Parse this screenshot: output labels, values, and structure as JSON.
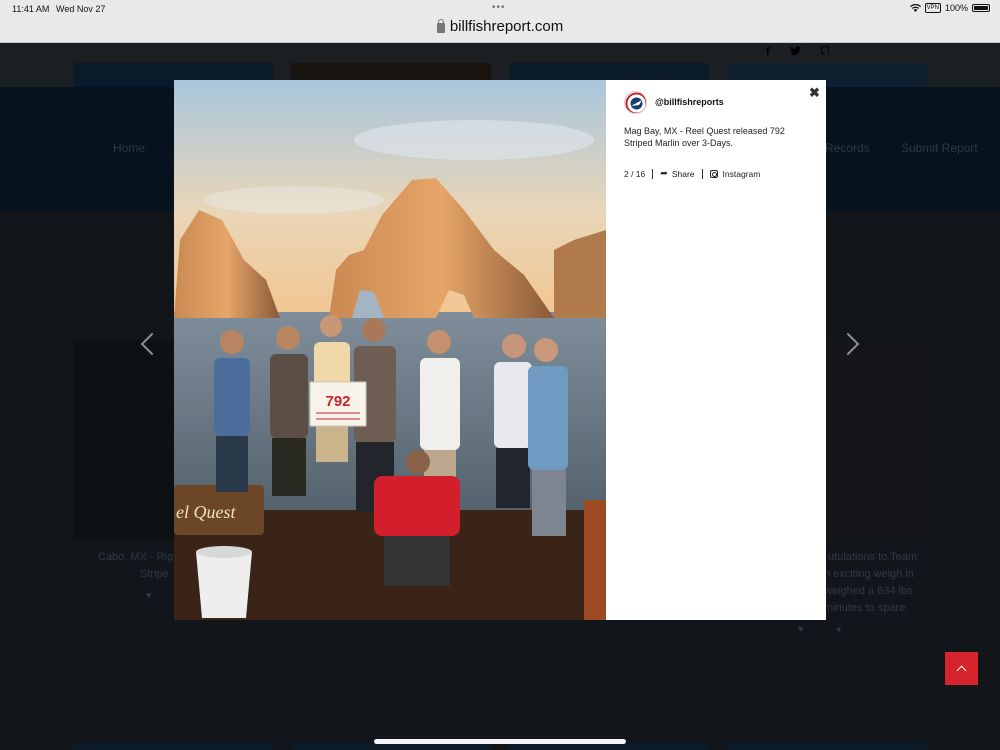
{
  "status_bar": {
    "time": "11:41 AM",
    "date": "Wed Nov 27",
    "vpn": "VPN",
    "battery": "100%"
  },
  "browser": {
    "url": "billfishreport.com"
  },
  "nav": {
    "home": "Home",
    "records": "Records",
    "submit": "Submit Report"
  },
  "cards": {
    "left_text_line1": "Cabo, MX - Right",
    "left_text_line2": "Stripe",
    "right_text_line1": "utulations to Team",
    "right_text_line2": "n exciting weigh in",
    "right_text_line3": "weighed a 634 lbs.",
    "right_text_line4": "minutes to spare."
  },
  "lightbox": {
    "handle": "@billfishreports",
    "caption": "Mag Bay, MX - Reel Quest released 792 Striped Marlin over 3-Days.",
    "counter": "2 / 16",
    "share_label": "Share",
    "instagram_label": "Instagram",
    "photo_sign": "792",
    "boat_name": "el Quest"
  },
  "colors": {
    "accent_red": "#d6242c",
    "nav_dark": "#06121e"
  },
  "icons": [
    "facebook-icon",
    "twitter-icon",
    "instagram-icon",
    "close-icon",
    "share-icon",
    "chevron-left-icon",
    "chevron-right-icon",
    "arrow-up-icon"
  ]
}
